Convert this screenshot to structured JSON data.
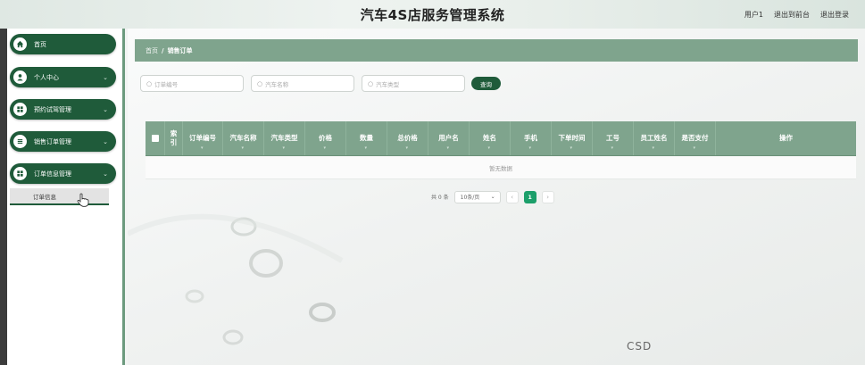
{
  "header": {
    "title": "汽车4S店服务管理系统",
    "links": [
      "用户1",
      "退出到前台",
      "退出登录"
    ]
  },
  "sidebar": {
    "items": [
      {
        "label": "首页",
        "icon": "home-icon",
        "has_arrow": false
      },
      {
        "label": "个人中心",
        "icon": "user-icon",
        "has_arrow": true
      },
      {
        "label": "预约试驾管理",
        "icon": "grid-icon",
        "has_arrow": true
      },
      {
        "label": "销售订单管理",
        "icon": "list-icon",
        "has_arrow": true
      },
      {
        "label": "订单信息管理",
        "icon": "grid-icon",
        "has_arrow": true
      }
    ],
    "submenu": {
      "label": "订单信息"
    }
  },
  "breadcrumb": {
    "home": "首页",
    "separator": "/",
    "current": "销售订单"
  },
  "search": {
    "order_no_placeholder": "订单编号",
    "car_name_placeholder": "汽车名称",
    "car_type_placeholder": "汽车类型",
    "button": "查询"
  },
  "table": {
    "columns": [
      "索引",
      "订单编号",
      "汽车名称",
      "汽车类型",
      "价格",
      "数量",
      "总价格",
      "用户名",
      "姓名",
      "手机",
      "下单时间",
      "工号",
      "员工姓名",
      "是否支付",
      "操作"
    ],
    "empty_text": "暂无数据"
  },
  "pagination": {
    "total": "共 0 条",
    "page_size": "10条/页",
    "current_page": "1"
  },
  "watermark": "CSD",
  "colors": {
    "primary_dark": "#1f5b3a",
    "header_green": "#7fa48d",
    "active_page": "#1c9f6a"
  }
}
